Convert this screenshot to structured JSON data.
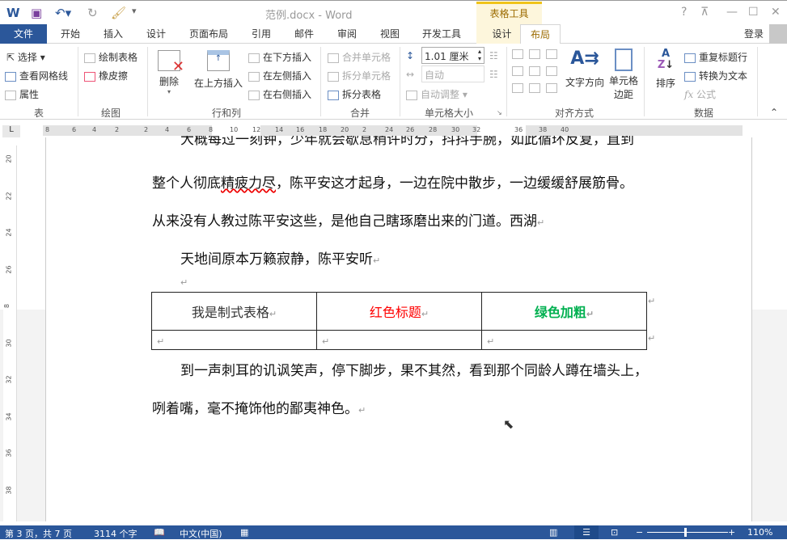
{
  "titlebar": {
    "title": "范例.docx - Word",
    "context_tab": "表格工具",
    "help": "?",
    "restore_ribbon": "⊼",
    "minimize": "—",
    "maximize": "☐",
    "close": "✕"
  },
  "tabs": [
    "开始",
    "插入",
    "设计",
    "页面布局",
    "引用",
    "邮件",
    "审阅",
    "视图",
    "开发工具"
  ],
  "file_tab": "文件",
  "design_tab": "设计",
  "layout_tab": "布局",
  "signin": "登录",
  "ribbon": {
    "table": {
      "label": "表",
      "select": "选择",
      "gridlines": "查看网格线",
      "properties": "属性"
    },
    "draw": {
      "label": "绘图",
      "draw_table": "绘制表格",
      "eraser": "橡皮擦"
    },
    "rows_cols": {
      "label": "行和列",
      "delete": "删除",
      "insert_above": "在上方插入",
      "insert_below": "在下方插入",
      "insert_left": "在左侧插入",
      "insert_right": "在右侧插入"
    },
    "merge": {
      "label": "合并",
      "merge_cells": "合并单元格",
      "split_cells": "拆分单元格",
      "split_table": "拆分表格"
    },
    "cell_size": {
      "label": "单元格大小",
      "height": "1.01 厘米",
      "width": "自动",
      "autofit": "自动调整"
    },
    "alignment": {
      "label": "对齐方式",
      "text_direction": "文字方向",
      "cell_margins_1": "单元格",
      "cell_margins_2": "边距"
    },
    "data": {
      "label": "数据",
      "sort": "排序",
      "repeat_header": "重复标题行",
      "convert": "转换为文本",
      "formula": "公式"
    }
  },
  "ruler": {
    "ticks": [
      "8",
      "6",
      "4",
      "2",
      "2",
      "4",
      "6",
      "8",
      "10",
      "12",
      "14",
      "16",
      "18",
      "20",
      "2",
      "24",
      "26",
      "28",
      "30",
      "32",
      "36",
      "38",
      "40"
    ]
  },
  "vruler": [
    "20",
    "22",
    "24",
    "26",
    "8",
    "30",
    "32",
    "34",
    "36",
    "38"
  ],
  "doc": {
    "line0": "大概每过一刻钟，少年就会歇息稍许时分，抖抖手腕，如此循环反复，直到",
    "line1a": "整个人彻底",
    "line1b": "精疲力尽",
    "line1c": "，陈平安这才起身，一边在院中散步，一边缓缓舒展筋骨。",
    "line2": "从来没有人教过陈平安这些，是他自己瞎琢磨出来的门道。西湖",
    "line3": "天地间原本万籁寂静，陈平安听",
    "cell1": "我是制式表格",
    "cell2": "红色标题",
    "cell3": "绿色加粗",
    "line4": "到一声刺耳的讥讽笑声，停下脚步，果不其然，看到那个同龄人蹲在墙头上，",
    "line5": "咧着嘴，毫不掩饰他的鄙夷神色。",
    "para_mark": "↵"
  },
  "colors": {
    "red": "#ff0000",
    "green": "#00b050",
    "brand": "#2b579a"
  },
  "status": {
    "page": "第 3 页，共 7 页",
    "words": "3114 个字",
    "lang": "中文(中国)",
    "zoom": "110%"
  }
}
